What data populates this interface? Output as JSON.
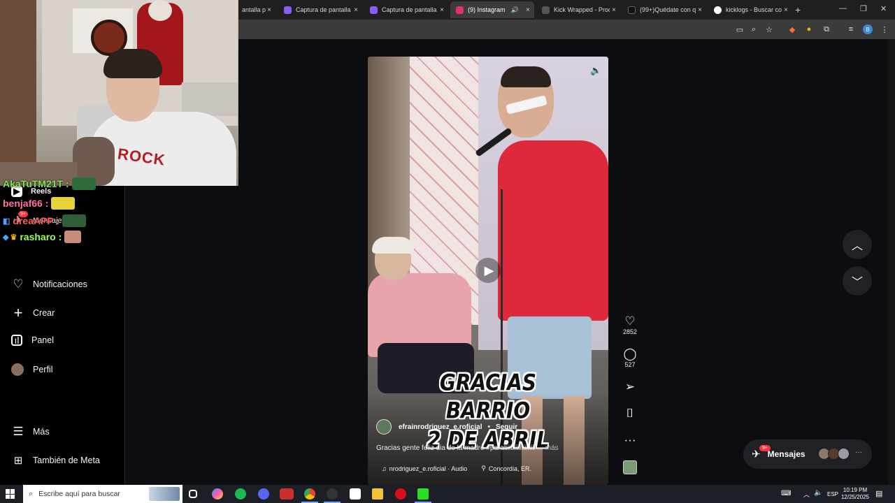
{
  "browser": {
    "tabs": [
      {
        "title": "antalla p",
        "active": false,
        "favicon_color": "#8a5cf6"
      },
      {
        "title": "Captura de pantalla p",
        "active": false,
        "favicon_color": "#8a5cf6"
      },
      {
        "title": "Captura de pantalla p",
        "active": false,
        "favicon_color": "#8a5cf6"
      },
      {
        "title": "(9) Instagram",
        "active": true,
        "favicon_color": "#e1306c"
      },
      {
        "title": "Kick Wrapped - Proc",
        "active": false,
        "favicon_color": "#555555"
      },
      {
        "title": "(99+)Quédate con q",
        "active": false,
        "favicon_color": "#111111"
      },
      {
        "title": "kicklogs - Buscar con",
        "active": false,
        "favicon_color": "#4285f4"
      }
    ],
    "new_tab_glyph": "+",
    "close_glyph": "×",
    "profile_initial": "B"
  },
  "sidebar": {
    "items": [
      {
        "label": "Reels",
        "icon": "reels-icon"
      },
      {
        "label": "Mensajes",
        "icon": "messages-icon",
        "badge": "9+"
      },
      {
        "label": "Notificaciones",
        "icon": "heart-icon"
      },
      {
        "label": "Crear",
        "icon": "plus-icon"
      },
      {
        "label": "Panel",
        "icon": "dashboard-icon"
      },
      {
        "label": "Perfil",
        "icon": "profile-avatar"
      },
      {
        "label": "Más",
        "icon": "menu-icon"
      },
      {
        "label": "También de Meta",
        "icon": "meta-apps-icon"
      }
    ]
  },
  "chat": [
    {
      "user": "AkaTuTM21T",
      "color": "#7fe05b",
      "sep": ":"
    },
    {
      "user": "benjaf66",
      "color": "#ff6fa5",
      "sep": ":"
    },
    {
      "user": "dreaAPP",
      "color": "#ff5a5a",
      "sep": ":"
    },
    {
      "user": "rasharo",
      "color": "#9cff5a",
      "sep": ":"
    }
  ],
  "webcam": {
    "hoodie_text": "ROCK"
  },
  "reel": {
    "overlay_lines": [
      "GRACIAS",
      "BARRIO",
      "2 DE ABRIL"
    ],
    "username": "efrainrodriguez_e.roficial",
    "follow_label": "Seguir",
    "caption": "Gracias gente feliz dia de la madre #paratiiiiiiiiiiiiiiiiiii",
    "more_label": "... más",
    "audio": "nrodriguez_e.roficial · Audio",
    "location": "Concordia, ER."
  },
  "actions": {
    "likes": "2852",
    "comments": "527"
  },
  "messages_pill": {
    "label": "Mensajes",
    "badge": "9+"
  },
  "taskbar": {
    "search_placeholder": "Escribe aquí para buscar",
    "language": "ESP",
    "time": "10:19 PM",
    "date": "12/25/2025"
  },
  "colors": {
    "instagram_red": "#ff3040",
    "reel_shirt": "#e0283c",
    "accent_blue": "#3b8bd8"
  }
}
